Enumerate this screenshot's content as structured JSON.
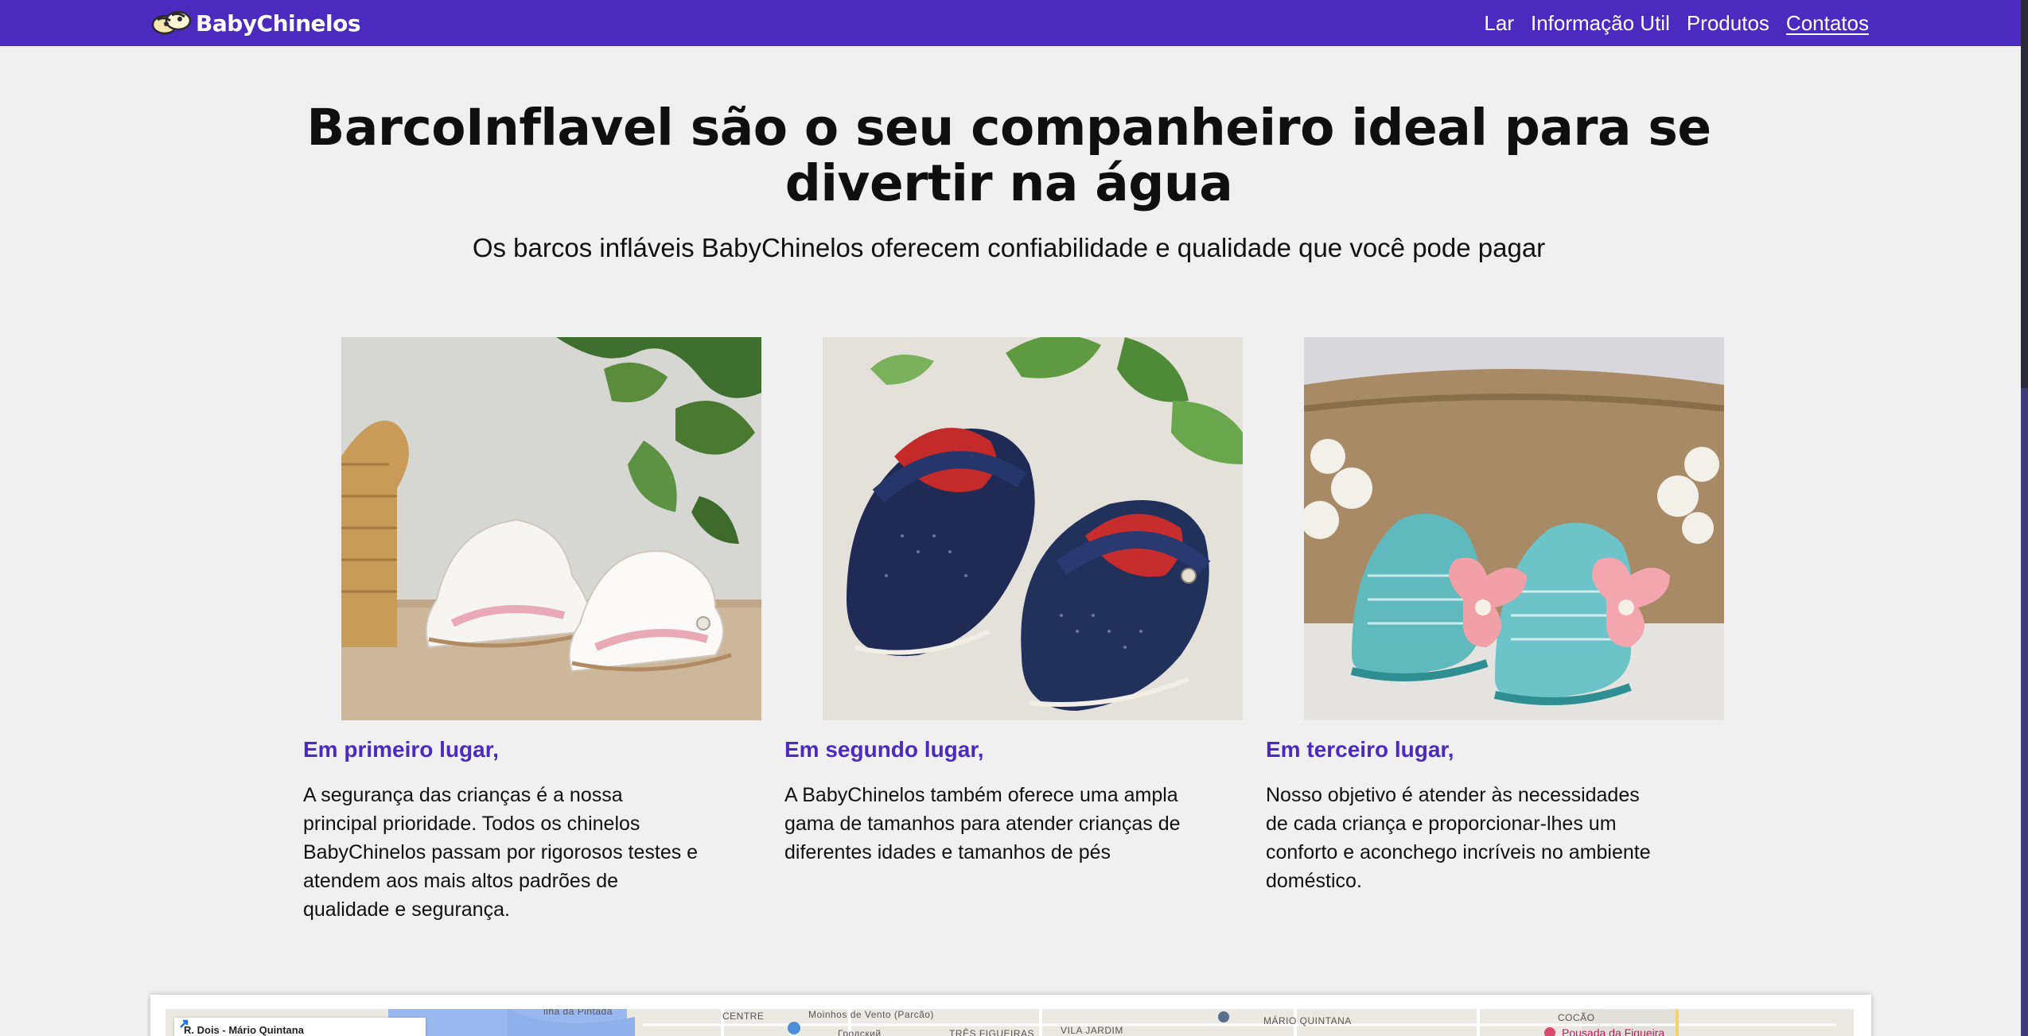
{
  "brand": {
    "name": "BabyChinelos",
    "logo_icon": "slippers-logo-icon"
  },
  "nav": {
    "items": [
      {
        "label": "Lar",
        "active": false
      },
      {
        "label": "Informação Util",
        "active": false
      },
      {
        "label": "Produtos",
        "active": false
      },
      {
        "label": "Contatos",
        "active": true
      }
    ]
  },
  "hero": {
    "title": "BarcoInflavel são o seu companheiro ideal para se divertir na água",
    "subtitle": "Os barcos infláveis BabyChinelos oferecem confiabilidade e qualidade que você pode pagar"
  },
  "features": [
    {
      "heading": "Em primeiro lugar,",
      "text": "A segurança das crianças é a nossa principal prioridade. Todos os chinelos BabyChinelos passam por rigorosos testes e atendem aos mais altos padrões de qualidade e segurança.",
      "image": "white-baby-sandals-photo"
    },
    {
      "heading": "Em segundo lugar,",
      "text": "A BabyChinelos também oferece uma ampla gama de tamanhos para atender crianças de diferentes idades e tamanhos de pés",
      "image": "navy-baby-shoes-photo"
    },
    {
      "heading": "Em terceiro lugar,",
      "text": "Nosso objetivo é atender às necessidades de cada criança e proporcionar-lhes um conforto e aconchego incríveis no ambiente doméstico.",
      "image": "crochet-baby-booties-photo"
    }
  ],
  "map": {
    "place_title": "R. Dois - Mário Quintana",
    "labels": [
      "ilha da Pintada",
      "CENTRE",
      "Moinhos de Vento (Parcão)",
      "Гродский",
      "TRÊS FIGUEIRAS",
      "VILA JARDIM",
      "MÁRIO QUINTANA",
      "COCÃO",
      "Pousada da Figueira"
    ]
  },
  "colors": {
    "primary": "#4b2bbf",
    "background": "#f0f0f0",
    "text": "#111111"
  }
}
